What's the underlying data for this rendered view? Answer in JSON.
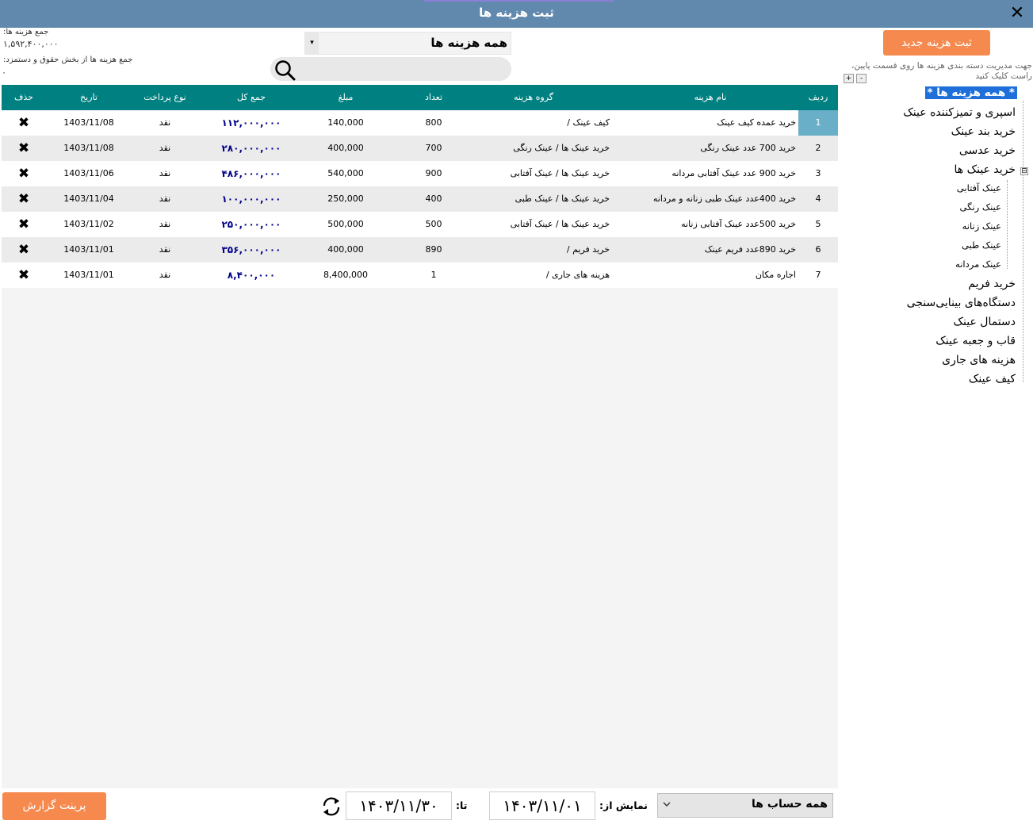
{
  "window": {
    "title": "ثبت هزینه ها",
    "close_label": "✕"
  },
  "summary": {
    "total_label": "جمع هزینه ها:",
    "total_value": "۱,۵۹۲,۴۰۰,۰۰۰",
    "payroll_label": "جمع هزینه ها از بخش حقوق و دستمزد:",
    "payroll_value": "۰"
  },
  "filter": {
    "selected": "همه هزینه ها",
    "arrow": "▾"
  },
  "search": {
    "placeholder": "",
    "value": ""
  },
  "table": {
    "headers": {
      "rownum": "ردیف",
      "name": "نام هزینه",
      "group": "گروه هزینه",
      "count": "تعداد",
      "amount": "مبلغ",
      "total": "جمع کل",
      "paytype": "نوع پرداخت",
      "date": "تاریخ",
      "delete": "حذف"
    },
    "rows": [
      {
        "rownum": "1",
        "name": "خرید عمده کیف عینک",
        "group": "کیف عینک /",
        "count": "800",
        "amount": "140,000",
        "total": "۱۱۲,۰۰۰,۰۰۰",
        "paytype": "نقد",
        "date": "1403/11/08",
        "delete": "✖"
      },
      {
        "rownum": "2",
        "name": "خرید 700 عدد عینک رنگی",
        "group": "خرید عینک ها  / عینک رنگی",
        "count": "700",
        "amount": "400,000",
        "total": "۲۸۰,۰۰۰,۰۰۰",
        "paytype": "نقد",
        "date": "1403/11/08",
        "delete": "✖"
      },
      {
        "rownum": "3",
        "name": "خرید 900 عدد عینک آفتابی مردانه",
        "group": "خرید عینک ها  / عینک آفتابی",
        "count": "900",
        "amount": "540,000",
        "total": "۴۸۶,۰۰۰,۰۰۰",
        "paytype": "نقد",
        "date": "1403/11/06",
        "delete": "✖"
      },
      {
        "rownum": "4",
        "name": "خرید 400عدد عینک طبی زنانه و مردانه",
        "group": "خرید عینک ها  / عینک طبی",
        "count": "400",
        "amount": "250,000",
        "total": "۱۰۰,۰۰۰,۰۰۰",
        "paytype": "نقد",
        "date": "1403/11/04",
        "delete": "✖"
      },
      {
        "rownum": "5",
        "name": "خرید 500عدد عینک آفتابی زنانه",
        "group": "خرید عینک ها  / عینک آفتابی",
        "count": "500",
        "amount": "500,000",
        "total": "۲۵۰,۰۰۰,۰۰۰",
        "paytype": "نقد",
        "date": "1403/11/02",
        "delete": "✖"
      },
      {
        "rownum": "6",
        "name": "خرید 890عدد فریم عینک",
        "group": "خرید فریم /",
        "count": "890",
        "amount": "400,000",
        "total": "۳۵۶,۰۰۰,۰۰۰",
        "paytype": "نقد",
        "date": "1403/11/01",
        "delete": "✖"
      },
      {
        "rownum": "7",
        "name": "اجاره مکان",
        "group": "هزینه های جاری /",
        "count": "1",
        "amount": "8,400,000",
        "total": "۸,۴۰۰,۰۰۰",
        "paytype": "نقد",
        "date": "1403/11/01",
        "delete": "✖"
      }
    ]
  },
  "sidebar": {
    "new_button": "ثبت هزینه جدید",
    "hint": "جهت مدیریت دسته بندی هزینه ها روی قسمت پایین، راست کلیک کنید",
    "plus": "+",
    "minus": "-",
    "tree": {
      "root": "* همه هزینه ها *",
      "items": [
        "اسپری و تمیزکننده عینک",
        "خرید بند عینک",
        "خرید عدسی",
        "خرید عینک ها"
      ],
      "expander": "⊟",
      "sub_items": [
        "عینک آفتابی",
        "عینک رنگی",
        "عینک زنانه",
        "عینک طبی",
        "عینک مردانه"
      ],
      "more_items": [
        "خرید فریم",
        "دستگاه‌های بینایی‌سنجی",
        "دستمال عینک",
        "قاب و جعبه عینک",
        "هزینه های جاری",
        "کیف عینک"
      ]
    }
  },
  "footer": {
    "print_button": "پرینت گزارش",
    "to_label": "تا:",
    "to_date": "۱۴۰۳/۱۱/۳۰",
    "from_label": "نمایش از:",
    "from_date": "۱۴۰۳/۱۱/۰۱",
    "account_selected": "همه حساب ها"
  },
  "colors": {
    "titlebar": "#6189ad",
    "table_header": "#008080",
    "accent_button": "#f5894e",
    "tree_selected": "#1e6fd9",
    "total_text": "#00008b"
  }
}
